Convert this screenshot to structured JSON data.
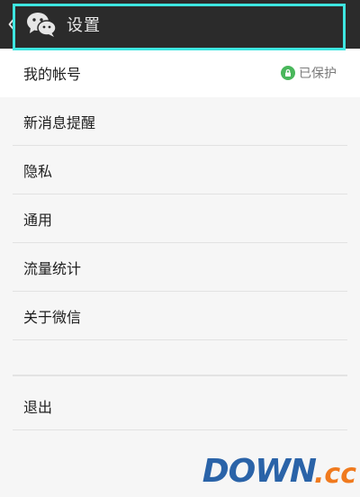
{
  "header": {
    "title": "设置",
    "back_icon": "chevron-left-icon",
    "logo_icon": "wechat-logo-icon"
  },
  "settings": {
    "items": [
      {
        "label": "我的帐号",
        "status": "已保护",
        "status_icon": "lock-icon"
      },
      {
        "label": "新消息提醒"
      },
      {
        "label": "隐私"
      },
      {
        "label": "通用"
      },
      {
        "label": "流量统计"
      },
      {
        "label": "关于微信"
      }
    ],
    "logout": {
      "label": "退出"
    }
  },
  "watermark": {
    "main": "DOWN",
    "tld": ".cc"
  },
  "colors": {
    "topbar": "#2b2b2b",
    "highlight": "#3ee6e1",
    "lock": "#49b75b",
    "watermark_blue": "#2a63a8",
    "watermark_orange": "#f07a1e"
  }
}
